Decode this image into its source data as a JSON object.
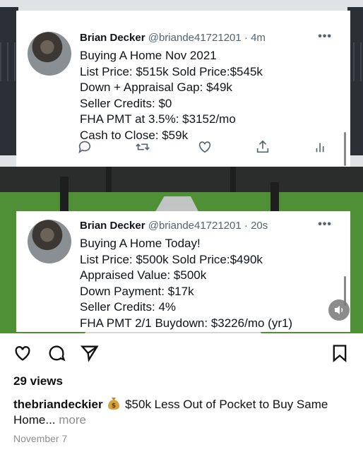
{
  "tweets": [
    {
      "name": "Brian Decker",
      "handle_time": "@briande41721201 · 4m",
      "lines": [
        "Buying A Home Nov 2021",
        "List Price: $515k  Sold Price:$545k",
        "Down + Appraisal Gap: $49k",
        "Seller Credits: $0",
        "FHA PMT at 3.5%: $3152/mo",
        "Cash to Close: $59k"
      ]
    },
    {
      "name": "Brian Decker",
      "handle_time": "@briande41721201 · 20s",
      "lines": [
        "Buying A Home Today!",
        "List Price: $500k  Sold Price:$490k",
        "Appraised Value: $500k",
        "Down Payment: $17k",
        "Seller Credits: 4%",
        "FHA PMT  2/1 Buydown: $3226/mo (yr1)"
      ]
    }
  ],
  "more_glyph": "•••",
  "post": {
    "views": "29 views",
    "username": "thebriandeckier",
    "caption_text": "$50k Less Out of Pocket to Buy Same Home...",
    "more_label": "more",
    "date": "November 7"
  },
  "icons": {
    "tweet_actions": [
      "reply-icon",
      "retweet-icon",
      "like-icon",
      "share-icon",
      "analytics-icon"
    ],
    "post_actions": [
      "heart-icon",
      "comment-icon",
      "send-icon",
      "bookmark-icon"
    ],
    "caption_emoji": "moneybag-icon",
    "video": "speaker-mute-icon"
  },
  "colors": {
    "tweet_meta": "#536471",
    "caption_muted": "#8e8e8e"
  }
}
